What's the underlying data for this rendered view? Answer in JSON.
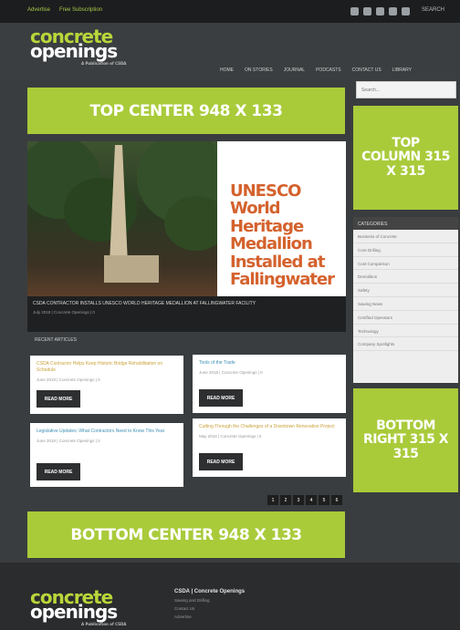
{
  "topbar": {
    "links": [
      "Advertise",
      "Free Subscription"
    ],
    "search_label": "SEARCH"
  },
  "logo": {
    "line1": "concrete",
    "line2": "openings",
    "tagline": "A Publication of CSDA"
  },
  "nav": [
    "HOME",
    "ON STORIES",
    "JOURNAL",
    "PODCASTS",
    "CONTACT US",
    "LIBRARY"
  ],
  "banners": {
    "top_center": "TOP CENTER 948 X 133",
    "top_column": "TOP COLUMN 315 X 315",
    "bottom_right": "BOTTOM RIGHT 315 X 315",
    "bottom_center": "BOTTOM CENTER 948 X 133"
  },
  "sidebar": {
    "search_placeholder": "Search...",
    "categories_title": "CATEGORIES",
    "categories": [
      "Business of Concrete",
      "Core Drilling",
      "Cost Comparison",
      "Demolition",
      "Safety",
      "Sawing News",
      "Certified Operators",
      "Technology",
      "Company Spotlights"
    ]
  },
  "feature": {
    "headline": "UNESCO World Heritage Medallion Installed at Fallingwater",
    "caption": "CSDA CONTRACTOR INSTALLS UNESCO WORLD HERITAGE MEDALLION AT FALLINGWATER FACILITY",
    "meta": "July 2018 | Concrete Openings | 0"
  },
  "recent_label": "RECENT ARTICLES",
  "cards": [
    {
      "title": "CSDA Contractor Helps Keep Historic Bridge Rehabilitation on Schedule",
      "meta": "June 2018 | Concrete Openings | 0",
      "button": "READ MORE"
    },
    {
      "title": "Tools of the Trade",
      "meta": "June 2018 | Concrete Openings | 0",
      "button": "READ MORE"
    },
    {
      "title": "Legislative Updates: What Contractors Need to Know This Year",
      "meta": "June 2018 | Concrete Openings | 0",
      "button": "READ MORE"
    },
    {
      "title": "Cutting Through the Challenges of a Downtown Renovation Project",
      "meta": "May 2018 | Concrete Openings | 0",
      "button": "READ MORE"
    }
  ],
  "pager": [
    "1",
    "2",
    "3",
    "4",
    "5",
    "6"
  ],
  "footer": {
    "title": "CSDA | Concrete Openings",
    "links": [
      "Sawing and Drilling",
      "Contact Us",
      "Advertise"
    ]
  },
  "colors": {
    "accent": "#a9cb3a",
    "headline": "#d4622d",
    "dark": "#2b2d2f"
  }
}
